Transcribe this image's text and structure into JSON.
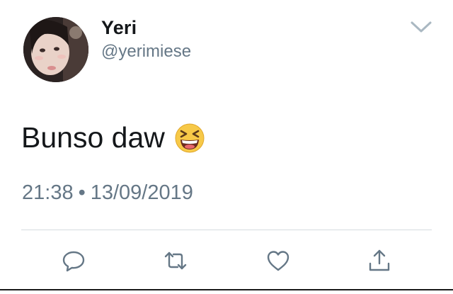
{
  "author": {
    "display_name": "Yeri",
    "handle": "@yerimiese"
  },
  "tweet": {
    "text": "Bunso daw",
    "emoji": "grinning-squinting-face-emoji",
    "time": "21:38",
    "separator": "•",
    "date": "13/09/2019"
  },
  "icons": {
    "menu": "chevron-down-icon",
    "reply": "reply-bubble-icon",
    "retweet": "retweet-icon",
    "like": "heart-icon",
    "share": "share-upload-icon"
  },
  "colors": {
    "text_primary": "#14171a",
    "text_secondary": "#657786",
    "icon": "#657786",
    "divider": "#d6dce0",
    "background": "#ffffff"
  }
}
